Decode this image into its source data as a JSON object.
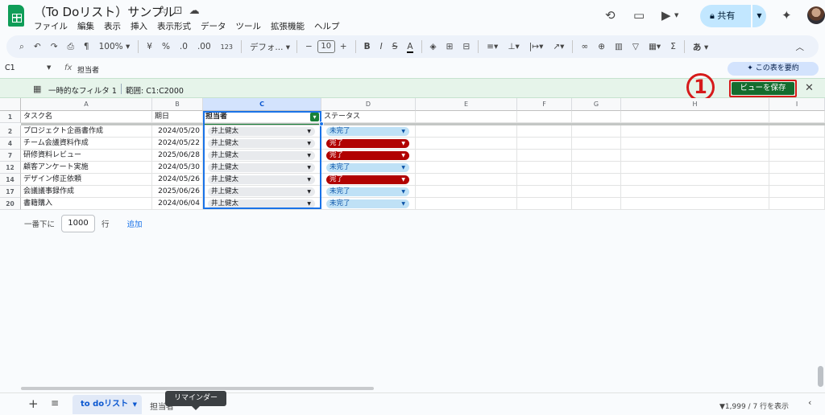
{
  "header": {
    "title": "（To Doリスト）サンプル",
    "menu": [
      "ファイル",
      "編集",
      "表示",
      "挿入",
      "表示形式",
      "データ",
      "ツール",
      "拡張機能",
      "ヘルプ"
    ],
    "share_label": "共有",
    "title_icons": [
      "☆",
      "⊡",
      "☁"
    ],
    "icons": [
      "history-icon",
      "comment-icon",
      "meet-icon",
      "gemini-icon",
      "avatar"
    ]
  },
  "toolbar": {
    "zoom": "100%",
    "currency": "¥",
    "percent": "%",
    "dec_less": ".0",
    "dec_more": ".00",
    "num_format": "123",
    "font": "デフォ...",
    "font_size": "10",
    "input_tool": "あ"
  },
  "formula_bar": {
    "cell_ref": "C1",
    "fx": "fx",
    "content": "担当者",
    "summarize_label": "この表を要約"
  },
  "filter_bar": {
    "name": "一時的なフィルタ 1",
    "range": "範囲:  C1:C2000",
    "save_view_label": "ビューを保存",
    "annotation": "1"
  },
  "grid": {
    "columns": [
      "A",
      "B",
      "C",
      "D",
      "E",
      "F",
      "G",
      "H",
      "I"
    ],
    "headers": {
      "task": "タスク名",
      "date": "期日",
      "owner": "担当者",
      "status": "ステータス"
    },
    "rows": [
      {
        "num": "2",
        "task": "プロジェクト企画書作成",
        "date": "2024/05/20",
        "owner": "井上健太",
        "status": "未完了",
        "done": false
      },
      {
        "num": "4",
        "task": "チーム会議資料作成",
        "date": "2024/05/22",
        "owner": "井上健太",
        "status": "完了",
        "done": true
      },
      {
        "num": "7",
        "task": "研修資料レビュー",
        "date": "2025/06/28",
        "owner": "井上健太",
        "status": "完了",
        "done": true
      },
      {
        "num": "12",
        "task": "顧客アンケート実施",
        "date": "2024/05/30",
        "owner": "井上健太",
        "status": "未完了",
        "done": false
      },
      {
        "num": "14",
        "task": "デザイン修正依頼",
        "date": "2024/05/26",
        "owner": "井上健太",
        "status": "完了",
        "done": true
      },
      {
        "num": "17",
        "task": "会議議事録作成",
        "date": "2025/06/26",
        "owner": "井上健太",
        "status": "未完了",
        "done": false
      },
      {
        "num": "20",
        "task": "書籍購入",
        "date": "2024/06/04",
        "owner": "井上健太",
        "status": "未完了",
        "done": false
      }
    ]
  },
  "add_rows": {
    "prefix": "一番下に",
    "count": "1000",
    "suffix": "行",
    "link": "追加"
  },
  "tabs": {
    "active": "to doリスト",
    "second": "担当者",
    "tooltip": "リマインダー",
    "row_count": "1,999 / 7 行を表示"
  }
}
